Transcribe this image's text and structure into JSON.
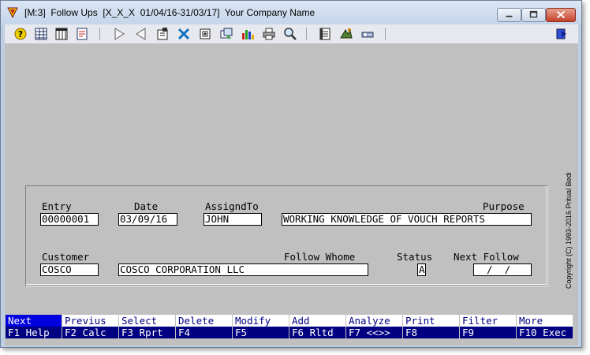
{
  "window": {
    "title": "[M:3]  Follow Ups  [X_X_X  01/04/16-31/03/17]  Your Company Name",
    "controls": {
      "minimize": "minimize-icon",
      "maximize": "maximize-icon",
      "close": "close-icon"
    }
  },
  "toolbar": {
    "buttons": [
      "help-icon",
      "grid-icon",
      "table-icon",
      "report-icon",
      "next-record-icon",
      "previous-record-icon",
      "new-record-icon",
      "tools-icon",
      "attach-icon",
      "browse-icon",
      "chart-icon",
      "print-icon",
      "find-icon",
      "notes-icon",
      "stamp-icon",
      "keys-icon",
      "exit-icon"
    ]
  },
  "copyright": "Copyright (C) 1993-2016 Pritual Bedi",
  "form": {
    "labels": {
      "entry": "Entry",
      "date": "Date",
      "assigned_to": "AssigndTo",
      "purpose": "Purpose",
      "customer": "Customer",
      "follow_whome": "Follow Whome",
      "status": "Status",
      "next_follow": "Next Follow"
    },
    "values": {
      "entry": "00000001",
      "date": "03/09/16",
      "assigned_to": "JOHN",
      "purpose": "WORKING KNOWLEDGE OF VOUCH REPORTS",
      "customer": "COSCO",
      "follow_whome": "COSCO CORPORATION LLC",
      "status": "A",
      "next_follow": "  /  /"
    }
  },
  "function_keys": [
    {
      "action": "Next",
      "key": "F1 Help",
      "active": true
    },
    {
      "action": "Previus",
      "key": "F2 Calc"
    },
    {
      "action": "Select",
      "key": "F3 Rprt"
    },
    {
      "action": "Delete",
      "key": "F4"
    },
    {
      "action": "Modify",
      "key": "F5"
    },
    {
      "action": "Add",
      "key": "F6 Rltd"
    },
    {
      "action": "Analyze",
      "key": "F7 <<>>"
    },
    {
      "action": "Print",
      "key": "F8"
    },
    {
      "action": "Filter",
      "key": "F9"
    },
    {
      "action": "More",
      "key": "F10 Exec"
    }
  ],
  "colors": {
    "fkey_bar": "#000080",
    "fkey_active": "#0000e0",
    "client_bg": "#c0c0c0"
  }
}
